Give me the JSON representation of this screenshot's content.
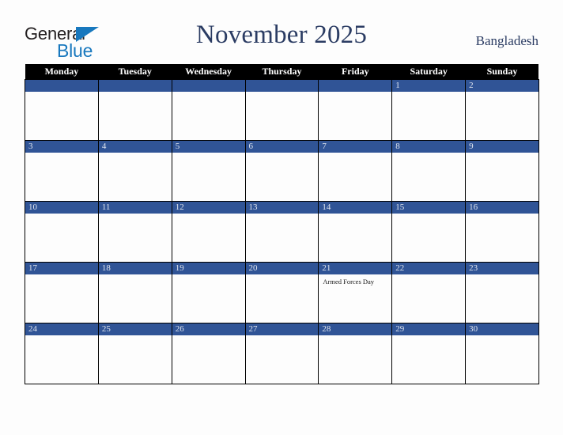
{
  "header": {
    "logo": {
      "word_one": "General",
      "word_two": "Blue",
      "triangle_icon": "triangle-icon",
      "brand_blue_hex": "#1878be",
      "brand_black_hex": "#231f20"
    },
    "title": "November 2025",
    "country": "Bangladesh",
    "title_color_hex": "#2b3c63"
  },
  "calendar": {
    "month": "November",
    "year": "2025",
    "week_start": "Monday",
    "header_bg_hex": "#000000",
    "header_text_hex": "#ffffff",
    "date_bar_hex": "#305496",
    "date_text_hex": "#dfe4ee",
    "grid_line_hex": "#000000",
    "weekdays": [
      "Monday",
      "Tuesday",
      "Wednesday",
      "Thursday",
      "Friday",
      "Saturday",
      "Sunday"
    ],
    "weeks": [
      [
        {
          "date": "",
          "events": []
        },
        {
          "date": "",
          "events": []
        },
        {
          "date": "",
          "events": []
        },
        {
          "date": "",
          "events": []
        },
        {
          "date": "",
          "events": []
        },
        {
          "date": "1",
          "events": []
        },
        {
          "date": "2",
          "events": []
        }
      ],
      [
        {
          "date": "3",
          "events": []
        },
        {
          "date": "4",
          "events": []
        },
        {
          "date": "5",
          "events": []
        },
        {
          "date": "6",
          "events": []
        },
        {
          "date": "7",
          "events": []
        },
        {
          "date": "8",
          "events": []
        },
        {
          "date": "9",
          "events": []
        }
      ],
      [
        {
          "date": "10",
          "events": []
        },
        {
          "date": "11",
          "events": []
        },
        {
          "date": "12",
          "events": []
        },
        {
          "date": "13",
          "events": []
        },
        {
          "date": "14",
          "events": []
        },
        {
          "date": "15",
          "events": []
        },
        {
          "date": "16",
          "events": []
        }
      ],
      [
        {
          "date": "17",
          "events": []
        },
        {
          "date": "18",
          "events": []
        },
        {
          "date": "19",
          "events": []
        },
        {
          "date": "20",
          "events": []
        },
        {
          "date": "21",
          "events": [
            "Armed Forces Day"
          ]
        },
        {
          "date": "22",
          "events": []
        },
        {
          "date": "23",
          "events": []
        }
      ],
      [
        {
          "date": "24",
          "events": []
        },
        {
          "date": "25",
          "events": []
        },
        {
          "date": "26",
          "events": []
        },
        {
          "date": "27",
          "events": []
        },
        {
          "date": "28",
          "events": []
        },
        {
          "date": "29",
          "events": []
        },
        {
          "date": "30",
          "events": []
        }
      ]
    ]
  }
}
